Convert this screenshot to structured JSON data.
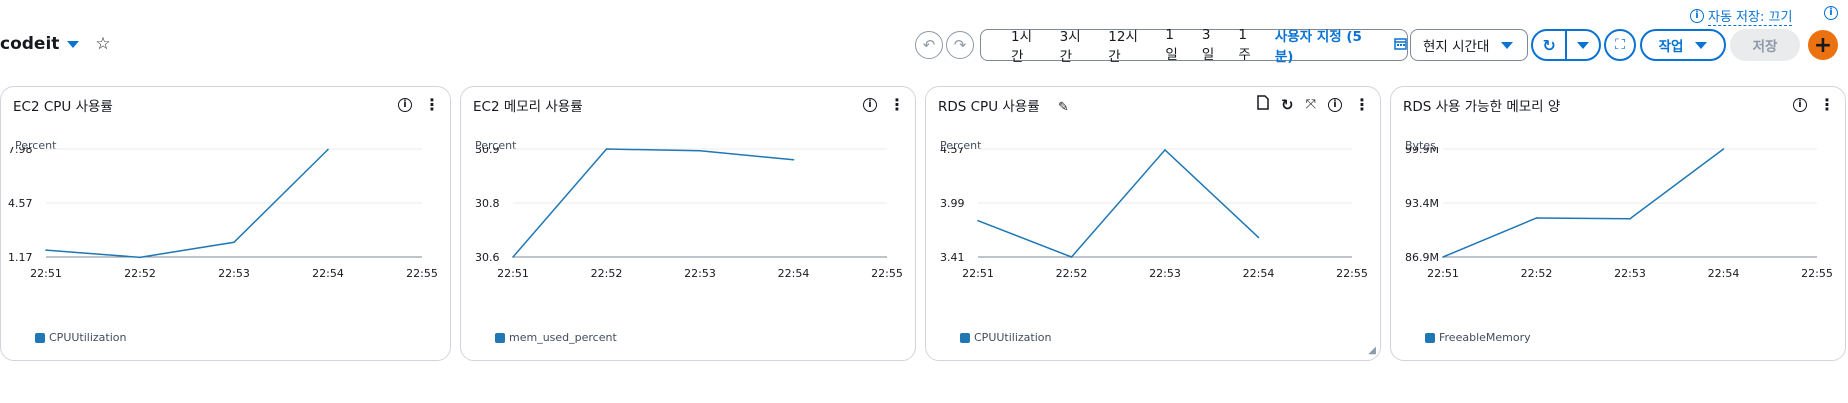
{
  "dashboard": {
    "name": "codeit",
    "autosave_label": "자동 저장: 끄기"
  },
  "toolbar": {
    "time_ranges": [
      "1시간",
      "3시간",
      "12시간",
      "1일",
      "3일",
      "1주"
    ],
    "custom_range": "사용자 지정 (5분)",
    "timezone": "현지 시간대",
    "actions_label": "작업",
    "save_label": "저장",
    "add_label": "+"
  },
  "icons": [
    "caret-down-icon",
    "star-icon",
    "info-icon",
    "undo-icon",
    "redo-icon",
    "calendar-icon",
    "refresh-icon",
    "fullscreen-icon",
    "plus-icon",
    "kebab-icon",
    "pencil-icon",
    "file-icon",
    "expand-icon",
    "resize-icon"
  ],
  "colors": {
    "accent": "#0972d3",
    "series": "#1f77b4",
    "add_button": "#ec7211"
  },
  "widgets": [
    {
      "title": "EC2 CPU 사용률",
      "unit": "Percent",
      "legend": "CPUUtilization",
      "chart_data": {
        "type": "line",
        "x": [
          "22:51",
          "22:52",
          "22:53",
          "22:54",
          "22:55"
        ],
        "yticks": [
          "7.98",
          "4.57",
          "1.17"
        ],
        "ylim": [
          1.17,
          7.98
        ],
        "series": [
          {
            "name": "CPUUtilization",
            "values": [
              1.6,
              1.15,
              2.1,
              7.95
            ]
          }
        ]
      }
    },
    {
      "title": "EC2 메모리 사용률",
      "unit": "Percent",
      "legend": "mem_used_percent",
      "chart_data": {
        "type": "line",
        "x": [
          "22:51",
          "22:52",
          "22:53",
          "22:54",
          "22:55"
        ],
        "yticks": [
          "30.9",
          "30.8",
          "30.6"
        ],
        "ylim": [
          30.6,
          30.9
        ],
        "series": [
          {
            "name": "mem_used_percent",
            "values": [
              30.6,
              30.9,
              30.895,
              30.87
            ]
          }
        ]
      }
    },
    {
      "title": "RDS CPU 사용률",
      "unit": "Percent",
      "legend": "CPUUtilization",
      "chart_data": {
        "type": "line",
        "x": [
          "22:51",
          "22:52",
          "22:53",
          "22:54",
          "22:55"
        ],
        "yticks": [
          "4.57",
          "3.99",
          "3.41"
        ],
        "ylim": [
          3.41,
          4.57
        ],
        "series": [
          {
            "name": "CPUUtilization",
            "values": [
              3.8,
              3.41,
              4.56,
              3.62
            ]
          }
        ]
      }
    },
    {
      "title": "RDS 사용 가능한 메모리 양",
      "unit": "Bytes",
      "legend": "FreeableMemory",
      "chart_data": {
        "type": "line",
        "x": [
          "22:51",
          "22:52",
          "22:53",
          "22:54",
          "22:55"
        ],
        "yticks": [
          "99.9M",
          "93.4M",
          "86.9M"
        ],
        "ylim": [
          86.9,
          99.9
        ],
        "series": [
          {
            "name": "FreeableMemory",
            "values": [
              86.9,
              91.6,
              91.5,
              99.9
            ]
          }
        ]
      }
    }
  ]
}
